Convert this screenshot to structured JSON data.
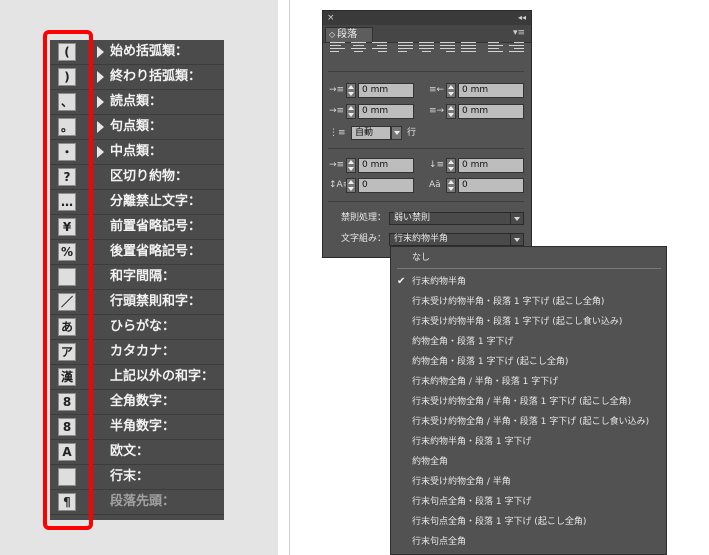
{
  "categories": [
    {
      "label": "始め括弧類：",
      "icon_glyph": "(",
      "icon": "open-bracket-icon",
      "expandable": true
    },
    {
      "label": "終わり括弧類：",
      "icon_glyph": ")",
      "icon": "close-bracket-icon",
      "expandable": true
    },
    {
      "label": "読点類：",
      "icon_glyph": "、",
      "icon": "comma-icon",
      "expandable": true
    },
    {
      "label": "句点類：",
      "icon_glyph": "。",
      "icon": "period-icon",
      "expandable": true
    },
    {
      "label": "中点類：",
      "icon_glyph": "・",
      "icon": "middle-dot-icon",
      "expandable": true
    },
    {
      "label": "区切り約物：",
      "icon_glyph": "?",
      "icon": "question-mark-icon",
      "expandable": false
    },
    {
      "label": "分離禁止文字：",
      "icon_glyph": "…",
      "icon": "ellipsis-icon",
      "expandable": false
    },
    {
      "label": "前置省略記号：",
      "icon_glyph": "¥",
      "icon": "yen-icon",
      "expandable": false
    },
    {
      "label": "後置省略記号：",
      "icon_glyph": "%",
      "icon": "percent-icon",
      "expandable": false
    },
    {
      "label": "和字間隔：",
      "icon_glyph": "",
      "icon": "ideographic-space-icon",
      "expandable": false
    },
    {
      "label": "行頭禁則和字：",
      "icon_glyph": "／",
      "icon": "slash-icon",
      "expandable": false
    },
    {
      "label": "ひらがな：",
      "icon_glyph": "あ",
      "icon": "hiragana-icon",
      "expandable": false
    },
    {
      "label": "カタカナ：",
      "icon_glyph": "ア",
      "icon": "katakana-icon",
      "expandable": false
    },
    {
      "label": "上記以外の和字：",
      "icon_glyph": "漢",
      "icon": "kanji-icon",
      "expandable": false
    },
    {
      "label": "全角数字：",
      "icon_glyph": "8",
      "icon": "fullwidth-digit-icon",
      "expandable": false
    },
    {
      "label": "半角数字：",
      "icon_glyph": "8",
      "icon": "halfwidth-digit-icon",
      "expandable": false
    },
    {
      "label": "欧文：",
      "icon_glyph": "A",
      "icon": "latin-icon",
      "expandable": false
    },
    {
      "label": "行末：",
      "icon_glyph": "",
      "icon": "line-end-icon",
      "expandable": false
    },
    {
      "label": "段落先頭：",
      "icon_glyph": "¶",
      "icon": "pilcrow-icon",
      "expandable": false,
      "dimmed": true
    }
  ],
  "paragraph_panel": {
    "close_glyph": "×",
    "collapse_glyph": "◂◂",
    "tab_label": "段落",
    "tab_icon": "◇",
    "menu_glyph": "▾≡",
    "left_indent": "0 mm",
    "right_indent": "0 mm",
    "first_line_indent": "0 mm",
    "last_line_indent": "0 mm",
    "autoleading": "自動",
    "leading_label": "行",
    "space_before": "0 mm",
    "space_after": "0 mm",
    "dropcap_lines": "0",
    "dropcap_chars": "0",
    "kinsoku_label": "禁則処理：",
    "kinsoku_value": "弱い禁則",
    "mojikumi_label": "文字組み：",
    "mojikumi_value": "行末約物半角"
  },
  "mojikumi_options": [
    {
      "label": "なし"
    },
    {
      "label": "行末約物半角",
      "checked": true
    },
    {
      "label": "行末受け約物半角・段落 1 字下げ (起こし全角)"
    },
    {
      "label": "行末受け約物半角・段落 1 字下げ (起こし食い込み)"
    },
    {
      "label": "約物全角・段落 1 字下げ"
    },
    {
      "label": "約物全角・段落 1 字下げ (起こし全角)"
    },
    {
      "label": "行末約物全角 / 半角・段落 1 字下げ"
    },
    {
      "label": "行末受け約物全角 / 半角・段落 1 字下げ (起こし全角)"
    },
    {
      "label": "行末受け約物全角 / 半角・段落 1 字下げ (起こし食い込み)"
    },
    {
      "label": "行末約物半角・段落 1 字下げ"
    },
    {
      "label": "約物全角"
    },
    {
      "label": "行末受け約物全角 / 半角"
    },
    {
      "label": "行末句点全角・段落 1 字下げ"
    },
    {
      "label": "行末句点全角・段落 1 字下げ (起こし全角)"
    },
    {
      "label": "行末句点全角"
    }
  ],
  "colors": {
    "highlight": "#ff0000",
    "panel": "#535353"
  }
}
